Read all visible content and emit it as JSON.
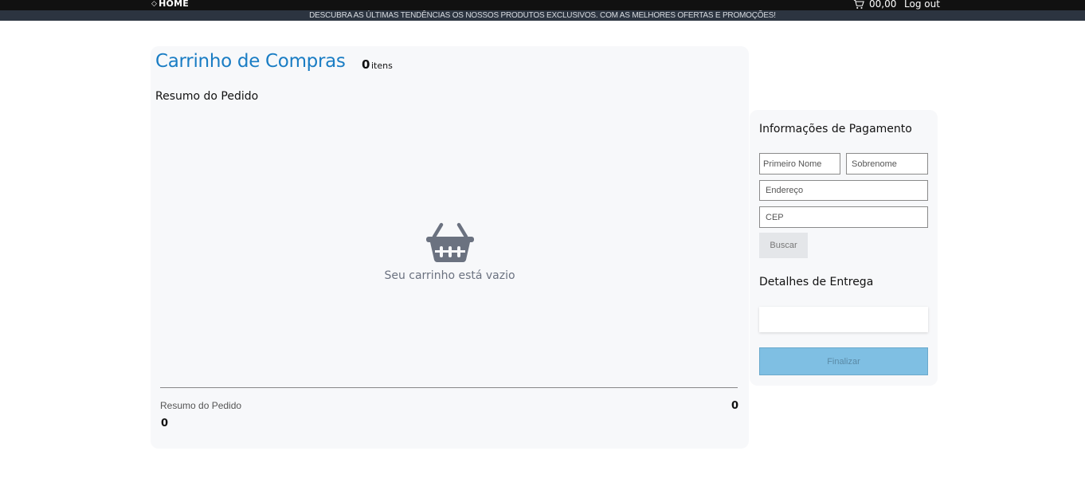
{
  "topbar": {
    "home_label": "HOME",
    "cart_total": "00,00",
    "logout_label": "Log out"
  },
  "promo": {
    "text": "DESCUBRA AS ÚLTIMAS TENDÊNCIAS OS NOSSOS PRODUTOS EXCLUSIVOS. COM AS MELHORES OFERTAS E PROMOÇÕES!"
  },
  "cart": {
    "title": "Carrinho de Compras",
    "count": "0",
    "count_label": "itens",
    "summary_heading": "Resumo do Pedido",
    "empty_text": "Seu carrinho está vazio",
    "footer_label": "Resumo do Pedido",
    "footer_value_right": "0",
    "footer_value_left": "0"
  },
  "payment": {
    "title": "Informações de Pagamento",
    "first_name_placeholder": "Primeiro Nome",
    "last_name_placeholder": "Sobrenome",
    "address_placeholder": "Endereço",
    "cep_placeholder": "CEP",
    "search_label": "Buscar",
    "delivery_title": "Detalhes de Entrega",
    "finish_label": "Finalizar"
  },
  "colors": {
    "title_blue": "#1a7dc4",
    "finish_button": "#7fbfe3",
    "topbar": "#111111",
    "promo_bar": "#2c3440"
  },
  "icons": [
    "home-icon",
    "cart-icon",
    "basket-icon"
  ]
}
